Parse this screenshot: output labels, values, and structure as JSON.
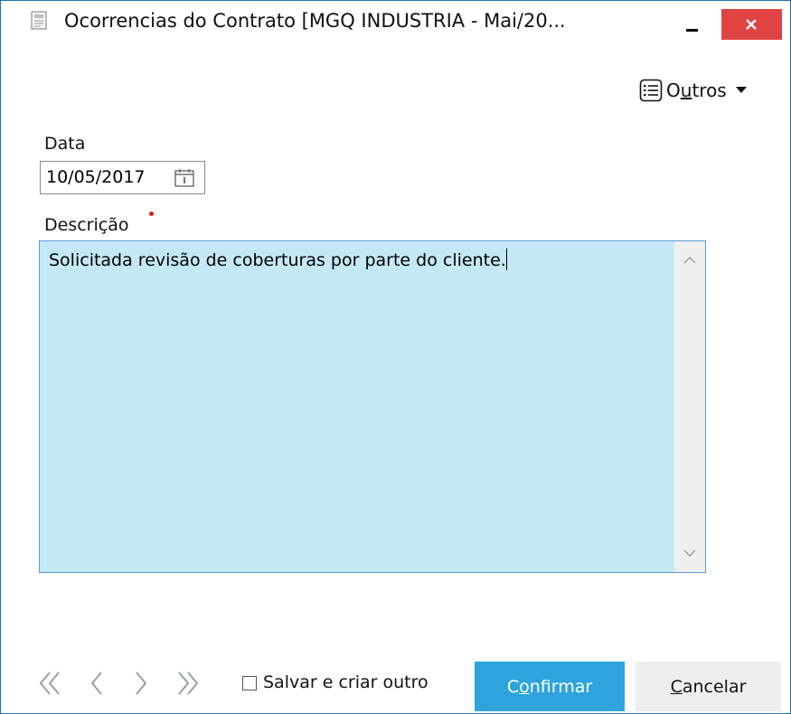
{
  "window": {
    "title": "Ocorrencias do Contrato [MGQ INDUSTRIA - Mai/20...",
    "minimize_icon": "minimize-icon",
    "close_icon": "close-icon",
    "close_color": "#e04343"
  },
  "toolbar": {
    "outros_label_prefix": "O",
    "outros_label_underlined": "u",
    "outros_label_suffix": "tros",
    "outros_icon": "list-icon"
  },
  "form": {
    "date_label": "Data",
    "date_value": "10/05/2017",
    "description_label": "Descrição",
    "description_required": true,
    "description_value": "Solicitada revisão de coberturas por parte do cliente.",
    "textarea_bg": "#c5e8f7"
  },
  "footer": {
    "nav_first": "first-record-icon",
    "nav_prev": "previous-record-icon",
    "nav_next": "next-record-icon",
    "nav_last": "last-record-icon",
    "save_and_new_label": "Salvar e criar outro",
    "save_and_new_checked": false,
    "confirm_prefix": "C",
    "confirm_underlined": "o",
    "confirm_suffix": "nfirmar",
    "cancel_underlined": "C",
    "cancel_suffix": "ancelar",
    "confirm_color": "#2ea4dd"
  }
}
